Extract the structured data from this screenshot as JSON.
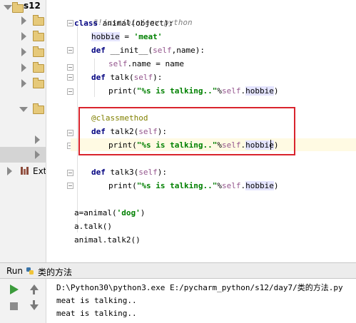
{
  "project_tree": {
    "root_label": "s12",
    "external_label": "Ext"
  },
  "editor": {
    "lines": [
      {
        "id": "l1",
        "text": "#!/usr/bin/env python"
      },
      {
        "id": "l2a",
        "text": "class"
      },
      {
        "id": "l2b",
        "text": " animal(object):"
      },
      {
        "id": "l3a",
        "text": "hobbie"
      },
      {
        "id": "l3b",
        "text": " = "
      },
      {
        "id": "l3c",
        "text": "'meat'"
      },
      {
        "id": "l4a",
        "text": "def"
      },
      {
        "id": "l4b",
        "text": " __init__("
      },
      {
        "id": "l4c",
        "text": "self"
      },
      {
        "id": "l4d",
        "text": ",name):"
      },
      {
        "id": "l5a",
        "text": "self"
      },
      {
        "id": "l5b",
        "text": ".name = name"
      },
      {
        "id": "l6a",
        "text": "def"
      },
      {
        "id": "l6b",
        "text": " talk("
      },
      {
        "id": "l6c",
        "text": "self"
      },
      {
        "id": "l6d",
        "text": "):"
      },
      {
        "id": "l7a",
        "text": "print("
      },
      {
        "id": "l7b",
        "text": "\"%s is talking..\""
      },
      {
        "id": "l7c",
        "text": "%"
      },
      {
        "id": "l7d",
        "text": "self"
      },
      {
        "id": "l7e",
        "text": "."
      },
      {
        "id": "l7f",
        "text": "hobbie"
      },
      {
        "id": "l7g",
        "text": ")"
      },
      {
        "id": "l8",
        "text": "@classmethod"
      },
      {
        "id": "l9a",
        "text": "def"
      },
      {
        "id": "l9b",
        "text": " talk2("
      },
      {
        "id": "l9c",
        "text": "self"
      },
      {
        "id": "l9d",
        "text": "):"
      },
      {
        "id": "l10a",
        "text": "print("
      },
      {
        "id": "l10b",
        "text": "\"%s is talking..\""
      },
      {
        "id": "l10c",
        "text": "%"
      },
      {
        "id": "l10d",
        "text": "self"
      },
      {
        "id": "l10e",
        "text": "."
      },
      {
        "id": "l10f",
        "text": "hobbie"
      },
      {
        "id": "l10g",
        "text": ")"
      },
      {
        "id": "l11a",
        "text": "def"
      },
      {
        "id": "l11b",
        "text": " talk3("
      },
      {
        "id": "l11c",
        "text": "self"
      },
      {
        "id": "l11d",
        "text": "):"
      },
      {
        "id": "l12a",
        "text": "print("
      },
      {
        "id": "l12b",
        "text": "\"%s is talking..\""
      },
      {
        "id": "l12c",
        "text": "%"
      },
      {
        "id": "l12d",
        "text": "self"
      },
      {
        "id": "l12e",
        "text": "."
      },
      {
        "id": "l12f",
        "text": "hobbie"
      },
      {
        "id": "l12g",
        "text": ")"
      },
      {
        "id": "l13a",
        "text": "a=animal("
      },
      {
        "id": "l13b",
        "text": "'dog'"
      },
      {
        "id": "l13c",
        "text": ")"
      },
      {
        "id": "l14",
        "text": "a.talk()"
      },
      {
        "id": "l15",
        "text": "animal.talk2()"
      }
    ]
  },
  "run_panel": {
    "tab_label": "Run",
    "config_name": "类的方法",
    "console_lines": [
      "D:\\Python30\\python3.exe E:/pycharm_python/s12/day7/类的方法.py",
      "meat is talking..",
      "meat is talking.."
    ]
  },
  "colors": {
    "highlight_box": "#d9242d",
    "keyword": "#000080",
    "string": "#008000",
    "self": "#94558d",
    "run_green": "#3c9b3c"
  }
}
